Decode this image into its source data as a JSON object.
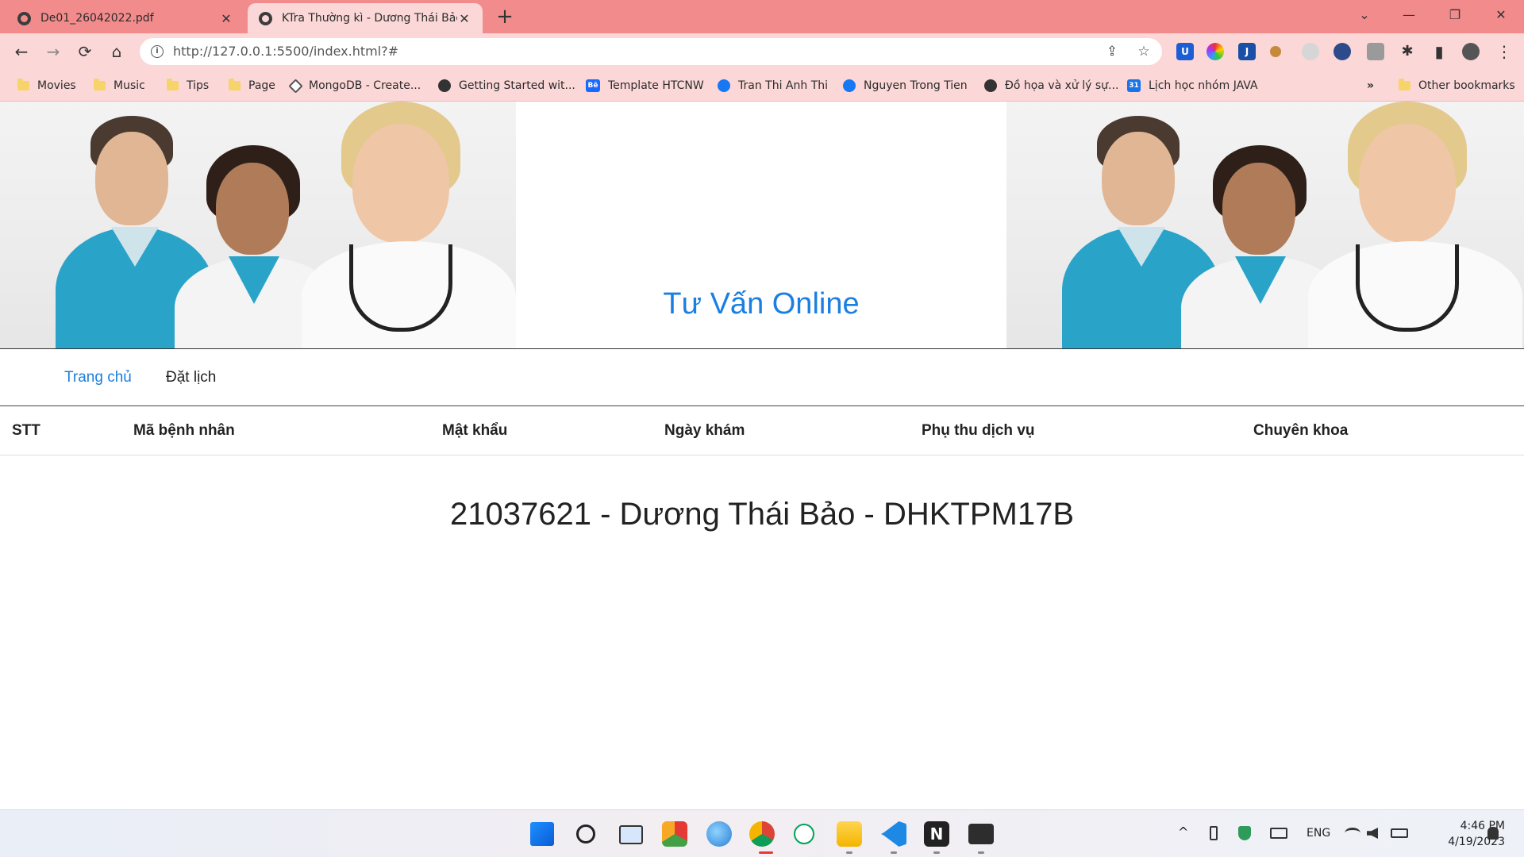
{
  "browser": {
    "tabs": [
      {
        "title": "De01_26042022.pdf",
        "active": false
      },
      {
        "title": "KTra Thường kì - Dương Thái Bảo",
        "active": true
      }
    ],
    "new_tab": "+",
    "window_controls": {
      "tab_search": "⌄",
      "minimize": "—",
      "restore": "❐",
      "close": "✕"
    },
    "url": "http://127.0.0.1:5500/index.html?#",
    "nav": {
      "back": "←",
      "forward": "→",
      "reload": "⟳",
      "home": "⌂"
    },
    "omnibox_icons": {
      "share": "⇪",
      "star": "☆"
    },
    "toolbar_icons": {
      "puzzle": "✱",
      "sidepanel": "▮",
      "menu": "⋮"
    },
    "bookmarks": [
      {
        "label": "Movies",
        "icon": "folder-icon"
      },
      {
        "label": "Music",
        "icon": "folder-icon"
      },
      {
        "label": "Tips",
        "icon": "folder-icon"
      },
      {
        "label": "Page",
        "icon": "folder-icon"
      },
      {
        "label": "MongoDB - Create...",
        "icon": "mongodb-icon"
      },
      {
        "label": "Getting Started wit...",
        "icon": "globe-icon"
      },
      {
        "label": "Template HTCNW",
        "icon": "behance-icon"
      },
      {
        "label": "Tran Thi Anh Thi",
        "icon": "facebook-icon"
      },
      {
        "label": "Nguyen Trong Tien",
        "icon": "facebook-icon"
      },
      {
        "label": "Đồ họa và xử lý sự...",
        "icon": "globe-icon"
      },
      {
        "label": "Lịch học nhóm JAVA",
        "icon": "calendar-icon"
      }
    ],
    "bookmarks_overflow": "»",
    "other_bookmarks": "Other bookmarks"
  },
  "page": {
    "hero_title": "Tư Vấn Online",
    "nav": [
      {
        "label": "Trang chủ",
        "active": true
      },
      {
        "label": "Đặt lịch",
        "active": false
      }
    ],
    "table_headers": [
      "STT",
      "Mã bệnh nhân",
      "Mật khẩu",
      "Ngày khám",
      "Phụ thu dịch vụ",
      "Chuyên khoa"
    ],
    "footer_text": "21037621 - Dương Thái Bảo - DHKTPM17B"
  },
  "taskbar": {
    "apps": [
      "windows-start",
      "search",
      "task-view",
      "app-red-green",
      "paint",
      "chrome",
      "mongodb-compass",
      "file-explorer",
      "vscode",
      "notion",
      "terminal"
    ],
    "tray": {
      "language": "ENG",
      "caret": "^"
    },
    "clock": {
      "time": "4:46 PM",
      "date": "4/19/2023"
    }
  },
  "colors": {
    "tabstrip": "#f28b8b",
    "toolbar": "#fbd7d7",
    "accent_blue": "#1a7fe0",
    "text_dark": "#222222"
  }
}
